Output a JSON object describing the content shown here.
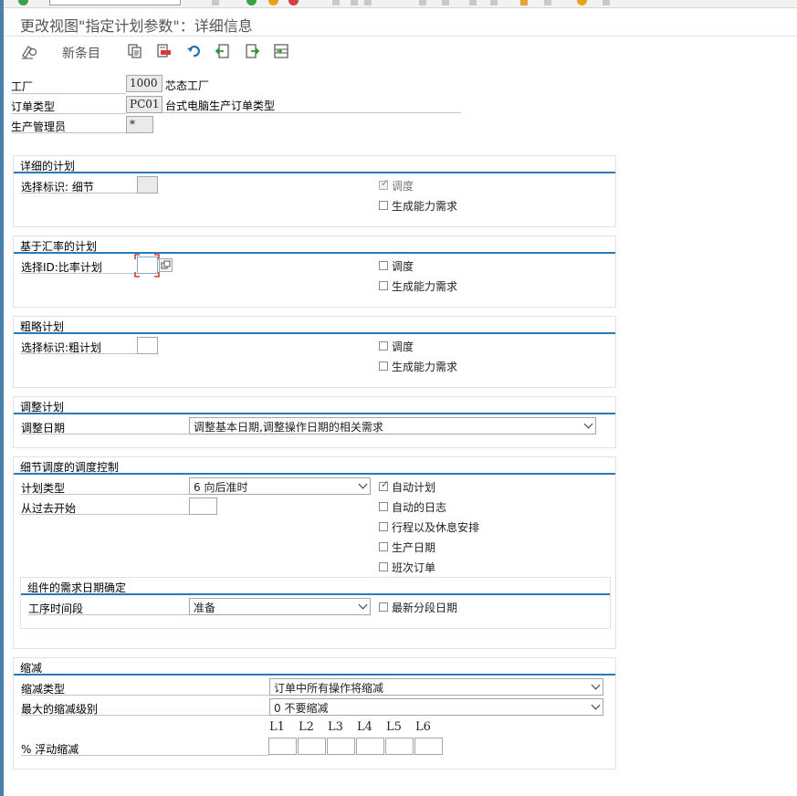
{
  "window": {
    "title": "更改视图\"指定计划参数\"：详细信息"
  },
  "toolbar": {
    "new_entries": "新条目"
  },
  "header": {
    "plant_label": "工厂",
    "plant_value": "1000",
    "plant_desc": "芯态工厂",
    "order_type_label": "订单类型",
    "order_type_value": "PC01",
    "order_type_desc": "台式电脑生产订单类型",
    "prod_mgr_label": "生产管理员",
    "prod_mgr_value": "*"
  },
  "detailed_planning": {
    "title": "详细的计划",
    "selection_label": "选择标识: 细节",
    "scheduling": "调度",
    "capacity": "生成能力需求"
  },
  "rate_planning": {
    "title": "基于汇率的计划",
    "selection_label": "选择ID:比率计划",
    "scheduling": "调度",
    "capacity": "生成能力需求"
  },
  "rough_planning": {
    "title": "粗略计划",
    "selection_label": "选择标识:粗计划",
    "scheduling": "调度",
    "capacity": "生成能力需求"
  },
  "adjust_planning": {
    "title": "调整计划",
    "date_label": "调整日期",
    "date_value": "调整基本日期,调整操作日期的相关需求"
  },
  "scheduling_control": {
    "title": "细节调度的调度控制",
    "plan_type_label": "计划类型",
    "plan_type_value": "6 向后准时",
    "start_past_label": "从过去开始",
    "auto_plan": "自动计划",
    "auto_log": "自动的日志",
    "schedule_breaks": "行程以及休息安排",
    "prod_date": "生产日期",
    "shift_order": "班次订单"
  },
  "component_req": {
    "title": "组件的需求日期确定",
    "op_segment_label": "工序时间段",
    "op_segment_value": "准备",
    "latest_segment": "最新分段日期"
  },
  "reduction": {
    "title": "缩减",
    "type_label": "缩减类型",
    "type_value": "订单中所有操作将缩减",
    "max_level_label": "最大的缩减级别",
    "max_level_value": "0 不要缩减",
    "levels": [
      "L1",
      "L2",
      "L3",
      "L4",
      "L5",
      "L6"
    ],
    "float_label": "% 浮动缩减"
  }
}
